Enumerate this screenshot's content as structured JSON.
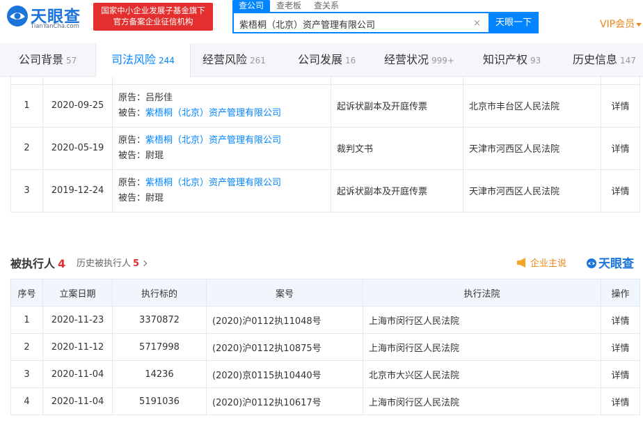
{
  "header": {
    "logo_text": "天眼查",
    "logo_sub": "TianYanCha.com",
    "badge_line1": "国家中小企业发展子基金旗下",
    "badge_line2": "官方备案企业征信机构",
    "search_tabs": [
      "查公司",
      "查老板",
      "查关系"
    ],
    "search_value": "紫梧桐（北京）资产管理有限公司",
    "clear_icon": "×",
    "search_button": "天眼一下",
    "vip_label": "VIP会员",
    "accent_color": "#0084ff"
  },
  "nav": [
    {
      "label": "公司背景",
      "count": "57"
    },
    {
      "label": "司法风险",
      "count": "244"
    },
    {
      "label": "经营风险",
      "count": "261"
    },
    {
      "label": "公司发展",
      "count": "16"
    },
    {
      "label": "经营状况",
      "count": "999+"
    },
    {
      "label": "知识产权",
      "count": "93"
    },
    {
      "label": "历史信息",
      "count": "147"
    }
  ],
  "lawsuits": {
    "rows": [
      {
        "no": "1",
        "date": "2020-09-25",
        "plaintiff_label": "原告：",
        "plaintiff": "吕彤佳",
        "defendant_label": "被告：",
        "defendant": "紫梧桐（北京）资产管理有限公司",
        "doc_type": "起诉状副本及开庭传票",
        "court": "北京市丰台区人民法院",
        "action": "详情"
      },
      {
        "no": "2",
        "date": "2020-05-19",
        "plaintiff_label": "原告：",
        "plaintiff": "紫梧桐（北京）资产管理有限公司",
        "defendant_label": "被告：",
        "defendant": "尉琨",
        "doc_type": "裁判文书",
        "court": "天津市河西区人民法院",
        "action": "详情"
      },
      {
        "no": "3",
        "date": "2019-12-24",
        "plaintiff_label": "原告：",
        "plaintiff": "紫梧桐（北京）资产管理有限公司",
        "defendant_label": "被告：",
        "defendant": "尉琨",
        "doc_type": "起诉状副本及开庭传票",
        "court": "天津市河西区人民法院",
        "action": "详情"
      }
    ]
  },
  "executed": {
    "title": "被执行人",
    "count": "4",
    "history_label": "历史被执行人",
    "history_count": "5",
    "promo_label": "企业主说",
    "watermark": "天眼查",
    "columns": [
      "序号",
      "立案日期",
      "执行标的",
      "案号",
      "执行法院",
      "操作"
    ],
    "rows": [
      {
        "no": "1",
        "date": "2020-11-23",
        "amount": "3370872",
        "case_no": "(2020)沪0112执11048号",
        "court": "上海市闵行区人民法院",
        "action": "详情"
      },
      {
        "no": "2",
        "date": "2020-11-12",
        "amount": "5717998",
        "case_no": "(2020)沪0112执10875号",
        "court": "上海市闵行区人民法院",
        "action": "详情"
      },
      {
        "no": "3",
        "date": "2020-11-04",
        "amount": "14236",
        "case_no": "(2020)京0115执10440号",
        "court": "北京市大兴区人民法院",
        "action": "详情"
      },
      {
        "no": "4",
        "date": "2020-11-04",
        "amount": "5191036",
        "case_no": "(2020)沪0112执10617号",
        "court": "上海市闵行区人民法院",
        "action": "详情"
      }
    ]
  }
}
